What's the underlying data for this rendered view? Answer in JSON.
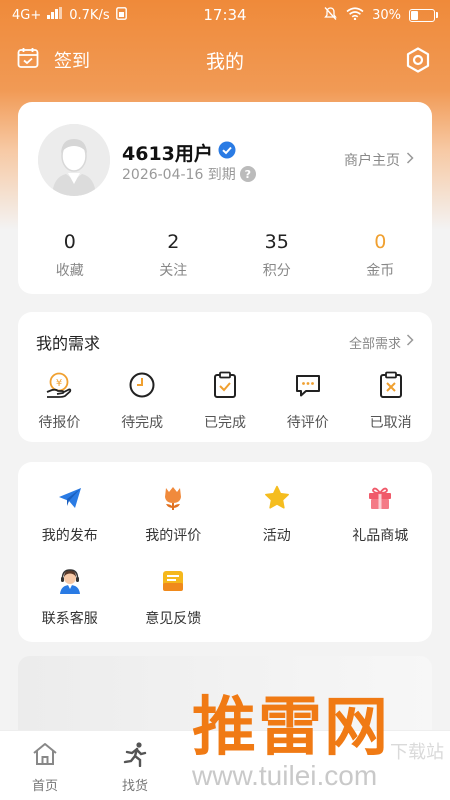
{
  "status_bar": {
    "network": "4G+",
    "speed": "0.7K/s",
    "time": "17:34",
    "battery": "30%"
  },
  "header": {
    "checkin_label": "签到",
    "title": "我的"
  },
  "profile": {
    "username": "4613用户",
    "expire": "2026-04-16 到期",
    "merchant_link": "商户主页",
    "stats": [
      {
        "value": "0",
        "label": "收藏"
      },
      {
        "value": "2",
        "label": "关注"
      },
      {
        "value": "35",
        "label": "积分"
      },
      {
        "value": "0",
        "label": "金币"
      }
    ]
  },
  "needs": {
    "title": "我的需求",
    "all_link": "全部需求",
    "items": [
      {
        "icon": "quote-yuan-icon",
        "label": "待报价"
      },
      {
        "icon": "clock-icon",
        "label": "待完成"
      },
      {
        "icon": "clipboard-check-icon",
        "label": "已完成"
      },
      {
        "icon": "comment-icon",
        "label": "待评价"
      },
      {
        "icon": "clipboard-x-icon",
        "label": "已取消"
      }
    ]
  },
  "tools": {
    "items": [
      {
        "icon": "paper-plane-icon",
        "label": "我的发布"
      },
      {
        "icon": "tulip-icon",
        "label": "我的评价"
      },
      {
        "icon": "star-icon",
        "label": "活动"
      },
      {
        "icon": "gift-icon",
        "label": "礼品商城"
      },
      {
        "icon": "customer-service-icon",
        "label": "联系客服"
      },
      {
        "icon": "feedback-icon",
        "label": "意见反馈"
      }
    ]
  },
  "tabbar": {
    "items": [
      {
        "icon": "home-icon",
        "label": "首页"
      },
      {
        "icon": "runner-icon",
        "label": "找货"
      }
    ]
  },
  "watermark": {
    "text": "推雷网",
    "url": "www.tuilei.com",
    "sub": "下载站"
  },
  "colors": {
    "accent": "#f08a3c",
    "gold": "#f0a030",
    "blue": "#2a7be4"
  }
}
